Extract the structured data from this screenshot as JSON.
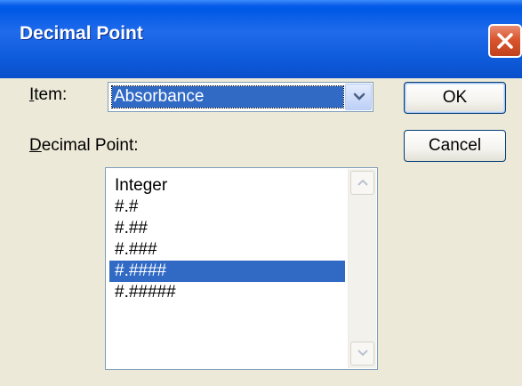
{
  "window": {
    "title": "Decimal Point",
    "close_icon": "close-x-icon"
  },
  "form": {
    "item_label_first": "I",
    "item_label_rest": "tem:",
    "item_value": "Absorbance",
    "decimal_label_first": "D",
    "decimal_label_rest": "ecimal Point:",
    "decimal_options": [
      "Integer",
      "#.#",
      "#.##",
      "#.###",
      "#.####",
      "#.#####"
    ],
    "selected_index": 4
  },
  "buttons": {
    "ok": "OK",
    "cancel": "Cancel"
  },
  "colors": {
    "titlebar": "#0A5CE8",
    "selection": "#316AC5",
    "dialog_face": "#ECE9D8",
    "close": "#D9552E"
  }
}
